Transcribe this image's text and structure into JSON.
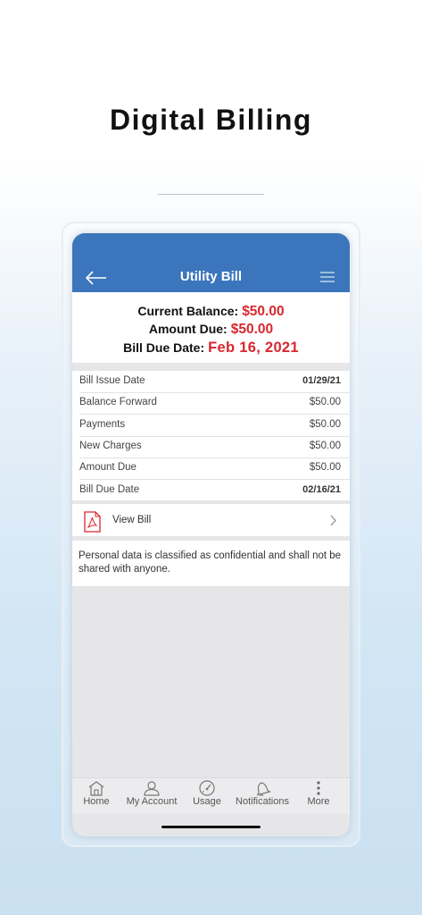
{
  "headline": "Digital Billing",
  "app": {
    "title": "Utility Bill",
    "back_icon": "arrow-left-icon",
    "menu_icon": "hamburger-menu-icon"
  },
  "summary": {
    "current_balance_label": "Current Balance:",
    "current_balance_value": "$50.00",
    "amount_due_label": "Amount Due:",
    "amount_due_value": "$50.00",
    "due_date_label": "Bill Due Date:",
    "due_date_value": "Feb 16, 2021",
    "accent_color": "#d8272e"
  },
  "details": [
    {
      "label": "Bill Issue Date",
      "value": "01/29/21"
    },
    {
      "label": "Balance Forward",
      "value": "$50.00"
    },
    {
      "label": "Payments",
      "value": "$50.00"
    },
    {
      "label": "New Charges",
      "value": "$50.00"
    },
    {
      "label": "Amount Due",
      "value": "$50.00"
    },
    {
      "label": "Bill Due Date",
      "value": "02/16/21"
    }
  ],
  "view_bill": {
    "label": "View Bill",
    "icon": "pdf-icon"
  },
  "notice": "Personal data is classified as confidential and shall not be shared with anyone.",
  "nav": [
    {
      "label": "Home",
      "icon": "home-icon"
    },
    {
      "label": "My Account",
      "icon": "user-icon"
    },
    {
      "label": "Usage",
      "icon": "gauge-icon"
    },
    {
      "label": "Notifications",
      "icon": "bell-icon"
    },
    {
      "label": "More",
      "icon": "more-vertical-icon"
    }
  ],
  "colors": {
    "brand_blue": "#3b76bc",
    "alert_red": "#d8272e"
  }
}
